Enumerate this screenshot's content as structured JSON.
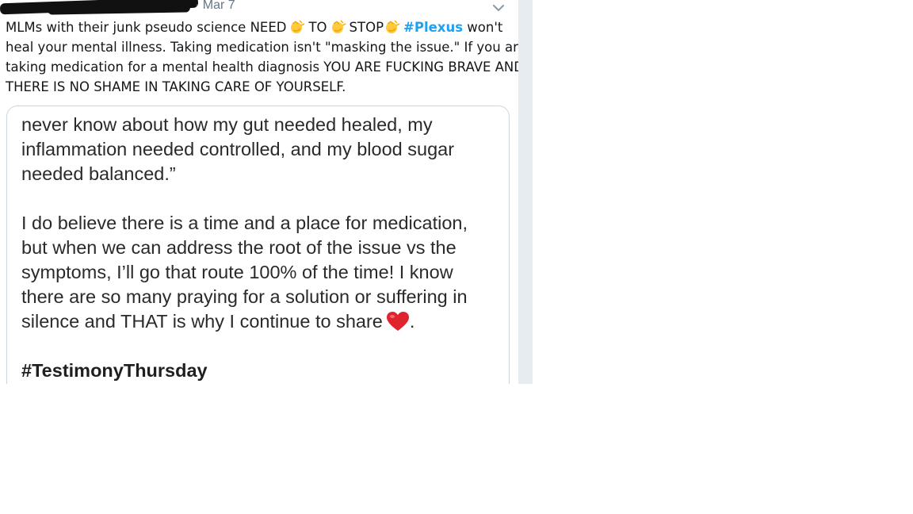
{
  "tweet": {
    "date": "· Mar 7",
    "lines": [
      {
        "a": "MLMs with their junk pseudo science NEED",
        "b": "TO",
        "c": "STOP",
        "hashtag": "#Plexus",
        "d": " won't"
      },
      "heal your mental illness. Taking medication isn't \"masking the issue.\" If you are",
      "taking medication for a mental health diagnosis YOU ARE FUCKING BRAVE AND",
      "THERE IS NO SHAME IN TAKING CARE OF YOURSELF."
    ],
    "icons": {
      "clap": "clapping-hands-icon",
      "menu": "chevron-down-icon"
    }
  },
  "media": {
    "lines": [
      "never know about how my gut needed healed, my",
      "inflammation needed controlled, and my blood sugar",
      "needed balanced.”",
      "",
      "I do believe there is a time and a place for medication,",
      "but when we can address the root of the issue vs the",
      "symptoms, I’ll go that route 100% of the time! I know",
      "there are so many praying for a solution or suffering in",
      "silence and THAT is why I continue to share"
    ],
    "end_punct": ".",
    "hashtag": "#TestimonyThursday",
    "icons": {
      "heart": "red-heart-icon"
    }
  },
  "colors": {
    "link": "#1da1f2",
    "meta": "#657786",
    "text": "#14171a",
    "gutter": "#e6ecf0"
  }
}
